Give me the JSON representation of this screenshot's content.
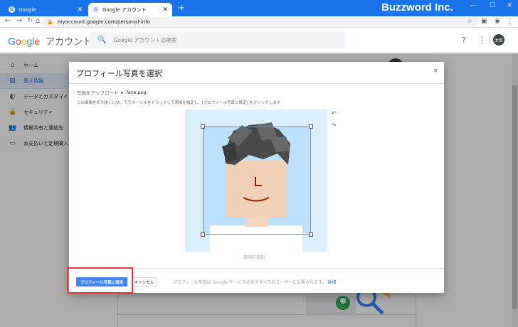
{
  "browser": {
    "tabs": [
      {
        "title": "Google",
        "favicon": "G"
      },
      {
        "title": "Google アカウント",
        "favicon": "G"
      }
    ],
    "brand": "Buzzword Inc.",
    "url": "myaccount.google.com/personal-info",
    "window_controls": {
      "minimize": "—",
      "maximize": "☐",
      "close": "✕"
    }
  },
  "header": {
    "logo_letters": [
      "G",
      "o",
      "o",
      "g",
      "l",
      "e"
    ],
    "logo_suffix": "アカウント",
    "search_placeholder": "Google アカウントの検索",
    "avatar_label": "太郎"
  },
  "sidebar": {
    "items": [
      {
        "label": "ホーム",
        "icon": "home-icon"
      },
      {
        "label": "個人情報",
        "icon": "id-card-icon",
        "selected": true
      },
      {
        "label": "データとカスタマイ",
        "icon": "toggle-icon"
      },
      {
        "label": "セキュリティ",
        "icon": "lock-icon"
      },
      {
        "label": "情報共有と連絡先",
        "icon": "people-icon"
      },
      {
        "label": "お支払いと定期購入",
        "icon": "card-icon"
      }
    ]
  },
  "dialog": {
    "title": "プロフィール写真を選択",
    "close": "×",
    "breadcrumb": {
      "parent": "写真をアップロード",
      "separator": "▸",
      "current": "face.png"
    },
    "instructions": "この画像を切り抜くには、下でカーソルをドラッグして領域を指定し、[プロフィール写真に設定] をクリックします",
    "rotate_left": "↶",
    "rotate_right": "↷",
    "add_caption": "説明を追加",
    "set_button": "プロフィール写真に設定",
    "cancel_button": "キャンセル",
    "footer_note": "プロフィール写真は Google サービス全体ですべてのユーザーに公開されます。",
    "footer_link": "詳細"
  },
  "colors": {
    "chrome": "#1a73e8",
    "primary_button": "#4285f4",
    "highlight": "#e53935",
    "photo_bg": "#bde0fc"
  }
}
